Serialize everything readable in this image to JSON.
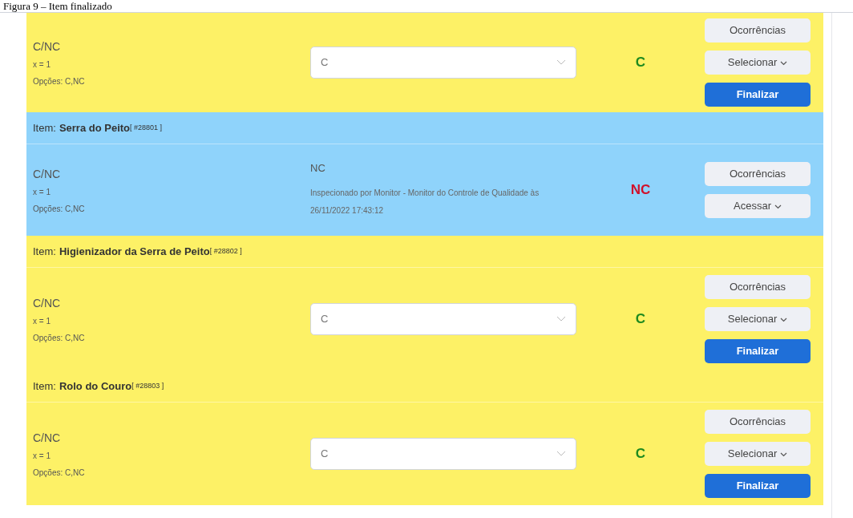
{
  "caption": "Figura 9 – Item finalizado",
  "items": [
    {
      "kind": "open",
      "question": "C/NC",
      "formula": "x = 1",
      "options": "Opções: C,NC",
      "select_value": "C",
      "result": "C",
      "color": "#1f8a1f",
      "buttons": [
        "Ocorrências",
        "Selecionar",
        "Finalizar"
      ]
    },
    {
      "kind": "finished",
      "label": "Item:",
      "name": "Serra do Peito",
      "code": "[ #28801 ]",
      "question": "C/NC",
      "formula": "x = 1",
      "options": "Opções: C,NC",
      "answer": "NC",
      "inspection": "Inspecionado por Monitor - Monitor do Controle de Qualidade às 26/11/2022 17:43:12",
      "result": "NC",
      "color": "#d0112b",
      "buttons": [
        "Ocorrências",
        "Acessar"
      ]
    },
    {
      "kind": "open",
      "label": "Item:",
      "name": "Higienizador da Serra de Peito",
      "code": "[ #28802 ]",
      "question": "C/NC",
      "formula": "x = 1",
      "options": "Opções: C,NC",
      "select_value": "C",
      "result": "C",
      "color": "#1f8a1f",
      "buttons": [
        "Ocorrências",
        "Selecionar",
        "Finalizar"
      ]
    },
    {
      "kind": "open",
      "label": "Item:",
      "name": "Rolo do Couro",
      "code": "[ #28803 ]",
      "question": "C/NC",
      "formula": "x = 1",
      "options": "Opções: C,NC",
      "select_value": "C",
      "result": "C",
      "color": "#1f8a1f",
      "buttons": [
        "Ocorrências",
        "Selecionar",
        "Finalizar"
      ]
    }
  ]
}
